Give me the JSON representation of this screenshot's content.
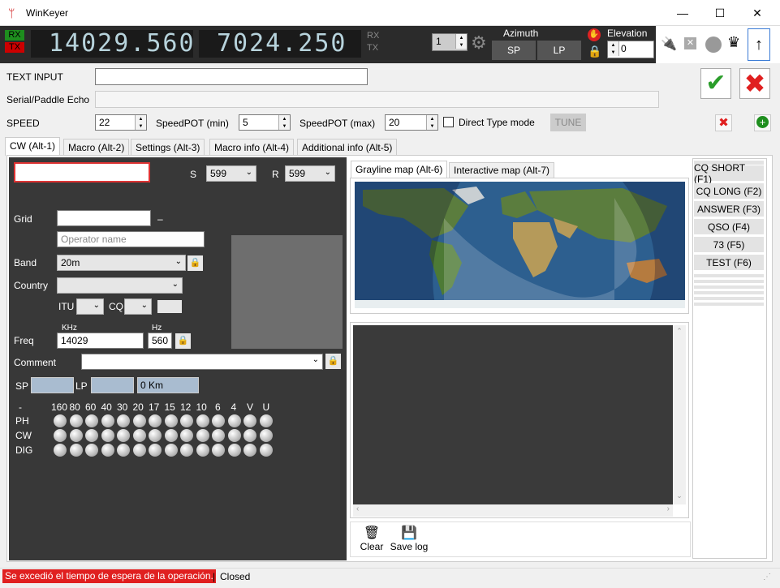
{
  "window": {
    "title": "WinKeyer",
    "minimize": "—",
    "maximize": "☐",
    "close": "✕"
  },
  "topbar": {
    "rx": "RX",
    "tx": "TX",
    "vfo_a": "14029.560",
    "vfo_b": "7024.250",
    "rx2": "RX",
    "tx2": "TX",
    "channel": "1",
    "azimuth_label": "Azimuth",
    "sp": "SP",
    "lp": "LP",
    "elevation_label": "Elevation",
    "elevation_value": "0"
  },
  "form": {
    "text_input_label": "TEXT INPUT",
    "echo_label": "Serial/Paddle Echo",
    "speed_label": "SPEED",
    "speed_value": "22",
    "pot_min_label": "SpeedPOT (min)",
    "pot_min_value": "5",
    "pot_max_label": "SpeedPOT (max)",
    "pot_max_value": "20",
    "direct_type_label": "Direct Type mode",
    "tune_label": "TUNE"
  },
  "tabs": [
    "CW (Alt-1)",
    "Macro (Alt-2)",
    "Settings (Alt-3)",
    "Macro info (Alt-4)",
    "Additional info (Alt-5)"
  ],
  "cw": {
    "s_label": "S",
    "s_value": "599",
    "r_label": "R",
    "r_value": "599",
    "grid_label": "Grid",
    "grid_dash": "–",
    "operator_placeholder": "Operator name",
    "band_label": "Band",
    "band_value": "20m",
    "country_label": "Country",
    "itu_label": "ITU",
    "cq_label": "CQ",
    "khz_label": "KHz",
    "hz_label": "Hz",
    "freq_label": "Freq",
    "freq_khz": "14029",
    "freq_hz": "560",
    "comment_label": "Comment",
    "sp_label": "SP",
    "lp_label": "LP",
    "distance": "0 Km",
    "band_header_dash": "-",
    "bands": [
      "160",
      "80",
      "60",
      "40",
      "30",
      "20",
      "17",
      "15",
      "12",
      "10",
      "6",
      "4",
      "V",
      "U"
    ],
    "modes": [
      "PH",
      "CW",
      "DIG"
    ]
  },
  "map_tabs": [
    "Grayline map (Alt-6)",
    "Interactive map (Alt-7)"
  ],
  "log": {
    "clear_label": "Clear",
    "save_label": "Save log"
  },
  "macros": [
    "CQ SHORT (F1)",
    "CQ LONG (F2)",
    "ANSWER (F3)",
    "QSO (F4)",
    "73 (F5)",
    "TEST (F6)"
  ],
  "status": {
    "error": "Se excedió el tiempo de espera de la operación.",
    "separator": "|",
    "state": "Closed"
  }
}
